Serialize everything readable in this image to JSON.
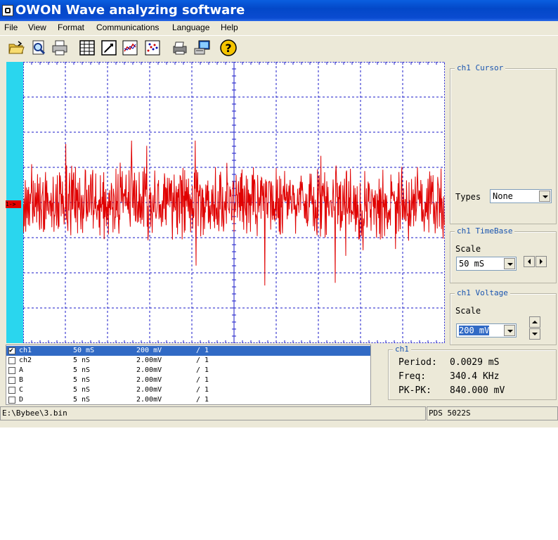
{
  "window": {
    "title": "OWON Wave analyzing software"
  },
  "menu": [
    "File",
    "View",
    "Format",
    "Communications",
    "Language",
    "Help"
  ],
  "toolbar": [
    "open-icon",
    "preview-icon",
    "print-icon",
    "table-icon",
    "edit-icon",
    "chart-icon",
    "scatter-icon",
    "printer2-icon",
    "scope-connect-icon",
    "help-icon"
  ],
  "scope": {
    "channel_marker": "1->",
    "trace_color": "#e00000",
    "grid_color": "#1a1ac8",
    "strip_color": "#2ad6ee"
  },
  "cursor_panel": {
    "title": "ch1 Cursor",
    "types_label": "Types",
    "types_value": "None"
  },
  "timebase_panel": {
    "title": "ch1 TimeBase",
    "scale_label": "Scale",
    "scale_value": "50 mS"
  },
  "voltage_panel": {
    "title": "ch1 Voltage",
    "scale_label": "Scale",
    "scale_value": "200 mV"
  },
  "channels": [
    {
      "name": "ch1",
      "time": "50  mS",
      "volt": "200 mV",
      "ratio": "/ 1",
      "checked": true,
      "active": true
    },
    {
      "name": "ch2",
      "time": "5  nS",
      "volt": "2.00mV",
      "ratio": "/ 1",
      "checked": false,
      "active": false
    },
    {
      "name": "A",
      "time": "5  nS",
      "volt": "2.00mV",
      "ratio": "/ 1",
      "checked": false,
      "active": false
    },
    {
      "name": "B",
      "time": "5  nS",
      "volt": "2.00mV",
      "ratio": "/ 1",
      "checked": false,
      "active": false
    },
    {
      "name": "C",
      "time": "5  nS",
      "volt": "2.00mV",
      "ratio": "/ 1",
      "checked": false,
      "active": false
    },
    {
      "name": "D",
      "time": "5  nS",
      "volt": "2.00mV",
      "ratio": "/ 1",
      "checked": false,
      "active": false
    }
  ],
  "measurement": {
    "title": "ch1",
    "period_label": "Period:",
    "period_value": "0.0029 mS",
    "freq_label": "Freq:",
    "freq_value": "340.4 KHz",
    "pkpk_label": "PK-PK:",
    "pkpk_value": "840.000 mV"
  },
  "status": {
    "path": "E:\\Bybee\\3.bin",
    "device": "PDS 5022S"
  }
}
